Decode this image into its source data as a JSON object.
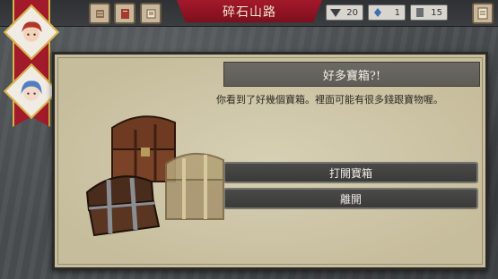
{
  "header": {
    "location": "碎石山路",
    "toolbar_icons": [
      "scroll-icon",
      "journal-icon",
      "quest-icon"
    ],
    "resources": [
      {
        "icon": "sword-icon",
        "value": "20"
      },
      {
        "icon": "crystal-icon",
        "value": "1"
      },
      {
        "icon": "card-icon",
        "value": "15"
      }
    ],
    "menu_icon": "menu-icon"
  },
  "party": {
    "members": [
      {
        "name": "red-haired-hero"
      },
      {
        "name": "blue-haired-hero"
      }
    ]
  },
  "dialog": {
    "title": "好多寶箱?!",
    "text": "你看到了好幾個寶箱。裡面可能有很多錢跟寶物喔。",
    "options": [
      "打開寶箱",
      "離開"
    ]
  },
  "colors": {
    "banner_red": "#a11b2a",
    "gold_trim": "#d7b24a",
    "parchment": "#cfc6a6",
    "button_dark": "#3a3a39"
  }
}
